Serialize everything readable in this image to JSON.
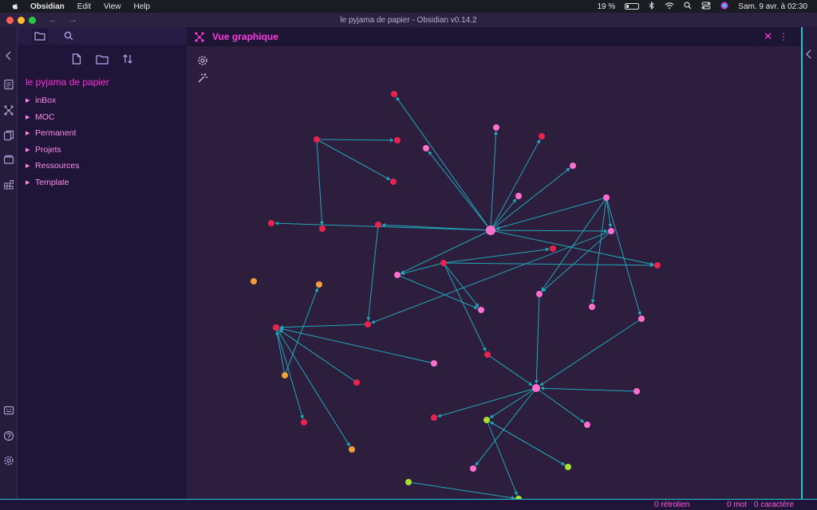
{
  "menubar": {
    "apple_icon": "apple-icon",
    "app": "Obsidian",
    "items": [
      "Edit",
      "View",
      "Help"
    ],
    "battery": "19 %",
    "datetime": "Sam. 9 avr. à  02:30"
  },
  "window": {
    "title": "le pyjama de papier - Obsidian v0.14.2",
    "traffic_colors": [
      "#ff5f57",
      "#febc2e",
      "#28c840"
    ]
  },
  "sidebar": {
    "vault_name": "le pyjama de papier",
    "folders": [
      "inBox",
      "MOC",
      "Permanent",
      "Projets",
      "Ressources",
      "Template"
    ]
  },
  "pane": {
    "title": "Vue graphique",
    "icon": "graph-icon"
  },
  "graph": {
    "edge_color": "#1fa8b8",
    "node_colors": {
      "red": "#e8244e",
      "pink": "#ff6fd0",
      "orange": "#f0a038",
      "green": "#a8e030"
    },
    "nodes": [
      {
        "id": "n1",
        "color": "red",
        "r": 4,
        "label": ""
      },
      {
        "id": "n2",
        "color": "red",
        "r": 4,
        "label": ""
      },
      {
        "id": "n3",
        "color": "pink",
        "r": 4,
        "label": ""
      },
      {
        "id": "n4",
        "color": "pink",
        "r": 4,
        "label": ""
      },
      {
        "id": "n5",
        "color": "red",
        "r": 4,
        "label": ""
      },
      {
        "id": "n6",
        "color": "pink",
        "r": 4,
        "label": ""
      },
      {
        "id": "n7",
        "color": "red",
        "r": 4,
        "label": ""
      },
      {
        "id": "n8",
        "color": "pink",
        "r": 4,
        "label": ""
      },
      {
        "id": "n9",
        "color": "red",
        "r": 4,
        "label": ""
      },
      {
        "id": "n10",
        "color": "red",
        "r": 4,
        "label": ""
      },
      {
        "id": "n11",
        "color": "pink",
        "r": 4,
        "label": ""
      },
      {
        "id": "n12",
        "color": "red",
        "r": 4,
        "label": ""
      },
      {
        "id": "n13",
        "color": "red",
        "r": 4,
        "label": ""
      },
      {
        "id": "n14",
        "color": "red",
        "r": 4,
        "label": ""
      },
      {
        "id": "hub1",
        "color": "pink",
        "r": 6,
        "label": ""
      },
      {
        "id": "n16",
        "color": "pink",
        "r": 4,
        "label": ""
      },
      {
        "id": "n17",
        "color": "red",
        "r": 4,
        "label": ""
      },
      {
        "id": "n18",
        "color": "red",
        "r": 4,
        "label": ""
      },
      {
        "id": "n19",
        "color": "red",
        "r": 4,
        "label": ""
      },
      {
        "id": "n20",
        "color": "pink",
        "r": 4,
        "label": ""
      },
      {
        "id": "n21",
        "color": "orange",
        "r": 4,
        "label": ""
      },
      {
        "id": "n22",
        "color": "orange",
        "r": 4,
        "label": ""
      },
      {
        "id": "n23",
        "color": "pink",
        "r": 4,
        "label": ""
      },
      {
        "id": "n24",
        "color": "pink",
        "r": 4,
        "label": ""
      },
      {
        "id": "n25",
        "color": "pink",
        "r": 4,
        "label": ""
      },
      {
        "id": "n26",
        "color": "red",
        "r": 4,
        "label": ""
      },
      {
        "id": "n27",
        "color": "pink",
        "r": 4,
        "label": ""
      },
      {
        "id": "n28",
        "color": "red",
        "r": 4,
        "label": ""
      },
      {
        "id": "n29",
        "color": "red",
        "r": 4,
        "label": ""
      },
      {
        "id": "n30",
        "color": "red",
        "r": 4,
        "label": ""
      },
      {
        "id": "n31",
        "color": "pink",
        "r": 4,
        "label": ""
      },
      {
        "id": "n32",
        "color": "orange",
        "r": 4,
        "label": ""
      },
      {
        "id": "n33",
        "color": "red",
        "r": 4,
        "label": ""
      },
      {
        "id": "hub2",
        "color": "pink",
        "r": 5,
        "label": ""
      },
      {
        "id": "n35",
        "color": "pink",
        "r": 4,
        "label": ""
      },
      {
        "id": "n36",
        "color": "red",
        "r": 4,
        "label": ""
      },
      {
        "id": "n37",
        "color": "orange",
        "r": 4,
        "label": ""
      },
      {
        "id": "n38",
        "color": "pink",
        "r": 4,
        "label": ""
      },
      {
        "id": "n39",
        "color": "green",
        "r": 4,
        "label": ""
      },
      {
        "id": "n40",
        "color": "green",
        "r": 4,
        "label": ""
      },
      {
        "id": "n41",
        "color": "pink",
        "r": 4,
        "label": ""
      },
      {
        "id": "n42",
        "color": "green",
        "r": 4,
        "label": ""
      },
      {
        "id": "n43",
        "color": "green",
        "r": 4,
        "label": ""
      }
    ],
    "edges": [
      [
        "n7",
        "n2"
      ],
      [
        "n7",
        "n9"
      ],
      [
        "n7",
        "n10"
      ],
      [
        "hub1",
        "n1"
      ],
      [
        "hub1",
        "n3"
      ],
      [
        "hub1",
        "n4"
      ],
      [
        "hub1",
        "n5"
      ],
      [
        "hub1",
        "n6"
      ],
      [
        "hub1",
        "n8"
      ],
      [
        "hub1",
        "n12"
      ],
      [
        "hub1",
        "n14"
      ],
      [
        "hub1",
        "n16"
      ],
      [
        "hub1",
        "n17"
      ],
      [
        "hub1",
        "n20"
      ],
      [
        "n11",
        "hub1"
      ],
      [
        "n11",
        "n16"
      ],
      [
        "n11",
        "n23"
      ],
      [
        "n11",
        "n24"
      ],
      [
        "n11",
        "n27"
      ],
      [
        "n16",
        "n26"
      ],
      [
        "n16",
        "n23"
      ],
      [
        "n19",
        "n18"
      ],
      [
        "n19",
        "n17"
      ],
      [
        "n19",
        "n25"
      ],
      [
        "n19",
        "n28"
      ],
      [
        "n19",
        "n20"
      ],
      [
        "n14",
        "n26"
      ],
      [
        "n20",
        "n25"
      ],
      [
        "n26",
        "n13"
      ],
      [
        "n13",
        "n30"
      ],
      [
        "n31",
        "n30"
      ],
      [
        "n32",
        "n30"
      ],
      [
        "n32",
        "n22"
      ],
      [
        "n30",
        "n33"
      ],
      [
        "n30",
        "n37"
      ],
      [
        "n29",
        "n30"
      ],
      [
        "n35",
        "hub2"
      ],
      [
        "n28",
        "hub2"
      ],
      [
        "n23",
        "hub2"
      ],
      [
        "n27",
        "hub2"
      ],
      [
        "hub2",
        "n36"
      ],
      [
        "hub2",
        "n38"
      ],
      [
        "hub2",
        "n39"
      ],
      [
        "hub2",
        "n41"
      ],
      [
        "n39",
        "n40"
      ],
      [
        "n39",
        "n42"
      ],
      [
        "n42",
        "n39"
      ],
      [
        "n43",
        "n40"
      ]
    ]
  },
  "status": {
    "backlinks": "0 rétrolien",
    "words": "0 mot",
    "chars": "0 caractère"
  }
}
